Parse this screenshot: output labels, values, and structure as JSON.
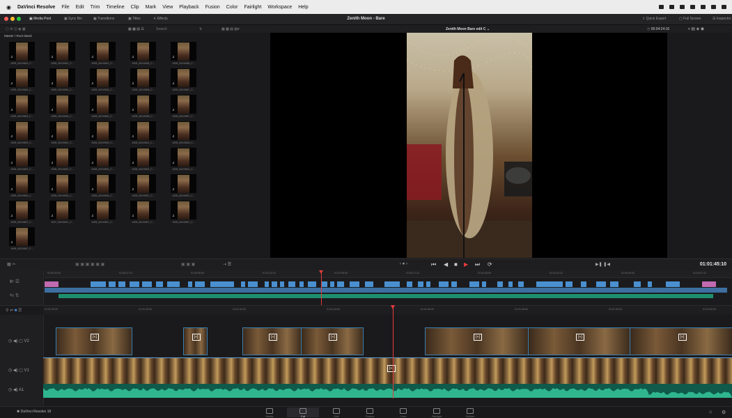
{
  "menubar": {
    "items": [
      "DaVinci Resolve",
      "File",
      "Edit",
      "Trim",
      "Timeline",
      "Clip",
      "Mark",
      "View",
      "Playback",
      "Fusion",
      "Color",
      "Fairlight",
      "Workspace",
      "Help"
    ]
  },
  "toolbar": {
    "project_title": "Zenith Moon - Bare",
    "media_pool": "Media Pool",
    "sync_bin": "Sync Bin",
    "transitions": "Transitions",
    "titles": "Titles",
    "effects": "Effects",
    "quick_export": "Quick Export",
    "full_screen": "Full Screen",
    "inspector": "Inspector"
  },
  "media_pool": {
    "search_placeholder": "Search",
    "path": "Master / Rock Band",
    "clips": [
      "A005_06240815_C...",
      "A005_06240822_C...",
      "A005_06240813_C...",
      "A005_06240834_C...",
      "A005_06240836_C...",
      "A005_06240824_C...",
      "A005_06240834_C...",
      "A005_06240818_C...",
      "A005_06240808_C...",
      "A005_06240847_C...",
      "A005_06240824_C...",
      "A005_06240834_C...",
      "A005_06240840_C...",
      "A005_06240838_C...",
      "A005_06240847_C...",
      "A006_06240825_C...",
      "A006_06240841_C...",
      "A006_06240839_C...",
      "A006_06240812_C...",
      "A005_06240826_C...",
      "A006_06240822_C...",
      "A006_06240822_C...",
      "A006_06240831_C...",
      "A006_06240822_C...",
      "A006_06240813_C...",
      "A005_06240824_C...",
      "A005_06240834_C...",
      "A006_06240834_C...",
      "A005_06240837_C...",
      "A005_06240837_C...",
      "A005_06240847_C...",
      "A007_06240847_C...",
      "A005_06240847_C...",
      "A006_06240847_C...",
      "A005_06240847_C...",
      "A006_06240847_C..."
    ]
  },
  "viewer": {
    "timeline_name": "Zenith Moon Bare edit C",
    "source_timecode": "00:04:24:16",
    "record_timecode": "01:01:45:10"
  },
  "upper_ruler": [
    "01:00:00:00",
    "01:00:27:12",
    "01:00:55:00",
    "01:01:22:12",
    "01:01:50:00",
    "01:02:17:12",
    "01:02:45:00",
    "01:03:12:12",
    "01:03:40:00",
    "01:04:07:12"
  ],
  "lower_ruler": [
    "01:01:30:00",
    "01:01:40:00",
    "01:01:42:00",
    "01:01:44:00",
    "01:01:46:00",
    "01:01:48:00",
    "01:01:50:00",
    "01:01:52:00"
  ],
  "page_bar": {
    "app_label": "DaVinci Resolve 18",
    "pages": [
      "Media",
      "Cut",
      "Edit",
      "Fusion",
      "Color",
      "Fairlight",
      "Deliver"
    ]
  },
  "colors": {
    "playhead": "#e53b3b",
    "clip_blue": "#3d7fb0",
    "audio_green": "#1a8a6a"
  }
}
